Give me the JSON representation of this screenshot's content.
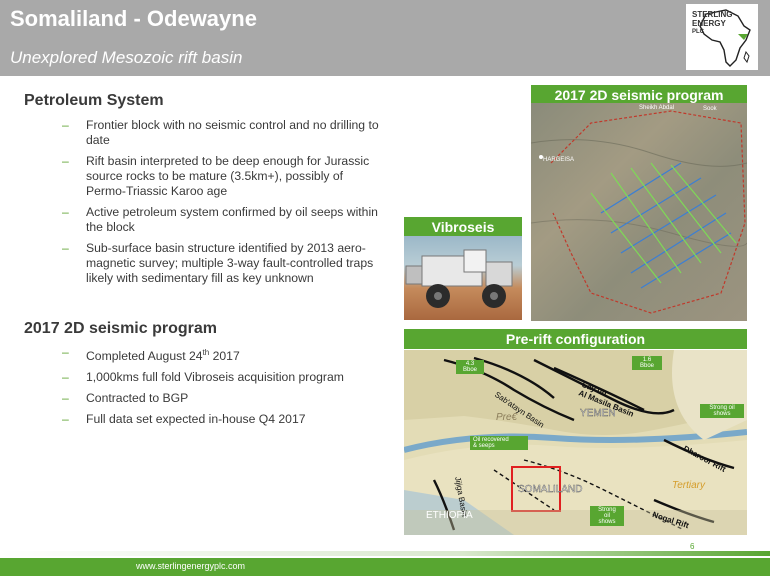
{
  "header": {
    "title": "Somaliland - Odewayne",
    "subtitle": "Unexplored Mesozoic rift basin",
    "logo_text_1": "STERLING",
    "logo_text_2": "ENERGY",
    "logo_text_3": "PLC"
  },
  "petroleum": {
    "heading": "Petroleum System",
    "bullets": [
      "Frontier block with no seismic control and no drilling to date",
      "Rift basin interpreted to be deep enough for Jurassic source rocks to be mature (3.5km+), possibly of Permo-Triassic Karoo age",
      "Active petroleum system confirmed by oil seeps within the block",
      "Sub-surface basin structure identified by 2013 aero-magnetic survey; multiple 3-way fault-controlled traps likely with sedimentary fill as key unknown"
    ]
  },
  "seismic": {
    "heading": "2017 2D seismic program",
    "bullet_1_prefix": "Completed August 24",
    "bullet_1_sup": "th",
    "bullet_1_suffix": " 2017",
    "bullets": [
      "1,000kms full fold Vibroseis acquisition program",
      "Contracted to BGP",
      "Full data set expected in-house Q4 2017"
    ]
  },
  "panels": {
    "seismic_title": "2017 2D seismic program",
    "vibroseis_title": "Vibroseis",
    "prerift_title": "Pre-rift configuration"
  },
  "seismic_map": {
    "place_1": "Sheikh Abdal",
    "place_2": "Sook",
    "place_3": "HARGEISA"
  },
  "prerift_map": {
    "callout_43": "4.3\nBboe",
    "callout_16": "1.6\nBboe",
    "basin_sabatayn": "Sab'atayn Basin",
    "basin_sayun": "Say'un\nAl Masila Basin",
    "yemen": "YEMEN",
    "pre_c": "Pre€",
    "strong_shows_1": "Strong oil\nshows",
    "oil_recovered": "Oil recovered\n& seeps",
    "dharoor": "Dharoor Rift",
    "tertiary": "Tertiary",
    "somaliland": "SOMALILAND",
    "jijiga": "Jijiga Basin",
    "ethiopia": "ETHIOPIA",
    "strong_shows_2": "Strong\noil\nshows",
    "nogal": "Nogal Rift"
  },
  "footer": {
    "url": "www.sterlingenergyplc.com",
    "page": "6"
  },
  "colors": {
    "accent_green": "#58a631",
    "header_gray": "#a9a9a9",
    "text_dark": "#3a3a3a"
  }
}
